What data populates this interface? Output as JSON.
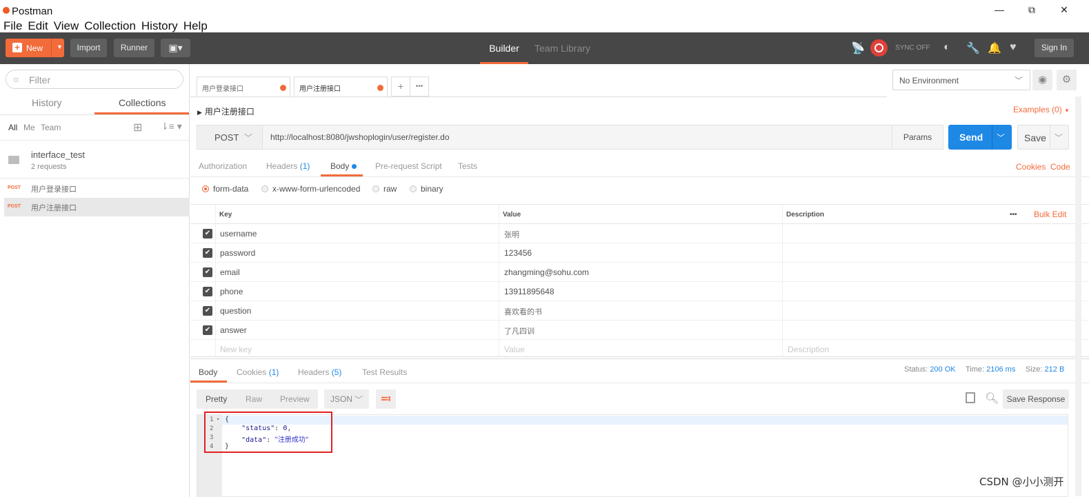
{
  "window": {
    "title": "Postman",
    "minimize": "—",
    "restore": "⧉",
    "close": "✕"
  },
  "menu": [
    "File",
    "Edit",
    "View",
    "Collection",
    "History",
    "Help"
  ],
  "header": {
    "new_label": "New",
    "import_label": "Import",
    "runner_label": "Runner",
    "builder_label": "Builder",
    "team_library_label": "Team Library",
    "sync_label": "SYNC OFF",
    "signin_label": "Sign In"
  },
  "sidebar": {
    "filter_placeholder": "Filter",
    "tabs": {
      "history": "History",
      "collections": "Collections"
    },
    "filters": {
      "all": "All",
      "me": "Me",
      "team": "Team"
    },
    "collection": {
      "name": "interface_test",
      "count": "2 requests"
    },
    "requests": [
      {
        "method": "POST",
        "name": "用户登录接口"
      },
      {
        "method": "POST",
        "name": "用户注册接口"
      }
    ]
  },
  "tabs": [
    {
      "label": "用户登录接口"
    },
    {
      "label": "用户注册接口"
    }
  ],
  "tab_actions": {
    "add": "+",
    "more": "•••"
  },
  "environment": {
    "selected": "No Environment"
  },
  "request": {
    "name": "用户注册接口",
    "examples": "Examples (0)",
    "method": "POST",
    "url": "http://localhost:8080/jwshoplogin/user/register.do",
    "params_label": "Params",
    "send_label": "Send",
    "save_label": "Save"
  },
  "request_tabs": {
    "authorization": "Authorization",
    "headers": "Headers",
    "headers_count": "(1)",
    "body": "Body",
    "pre_request": "Pre-request Script",
    "tests": "Tests",
    "cookies": "Cookies",
    "code": "Code"
  },
  "body_types": [
    "form-data",
    "x-www-form-urlencoded",
    "raw",
    "binary"
  ],
  "kv_table": {
    "headers": {
      "key": "Key",
      "value": "Value",
      "description": "Description"
    },
    "bulk_edit": "Bulk Edit",
    "more": "•••",
    "rows": [
      {
        "key": "username",
        "value": "张明"
      },
      {
        "key": "password",
        "value": "123456"
      },
      {
        "key": "email",
        "value": "zhangming@sohu.com"
      },
      {
        "key": "phone",
        "value": "13911895648"
      },
      {
        "key": "question",
        "value": "喜欢看的书"
      },
      {
        "key": "answer",
        "value": "了凡四训"
      }
    ],
    "placeholders": {
      "key": "New key",
      "value": "Value",
      "description": "Description"
    }
  },
  "response": {
    "tabs": {
      "body": "Body",
      "cookies": "Cookies",
      "cookies_count": "(1)",
      "headers": "Headers",
      "headers_count": "(5)",
      "test_results": "Test Results"
    },
    "status_label": "Status:",
    "status_value": "200 OK",
    "time_label": "Time:",
    "time_value": "2106 ms",
    "size_label": "Size:",
    "size_value": "212 B",
    "views": [
      "Pretty",
      "Raw",
      "Preview"
    ],
    "format": "JSON",
    "save_response": "Save Response",
    "lines": [
      "1",
      "2",
      "3",
      "4"
    ],
    "code": {
      "open": "{",
      "status_key": "\"status\"",
      "status_val": "0",
      "data_key": "\"data\"",
      "data_val": "\"注册成功\"",
      "close": "}"
    }
  },
  "watermark": "CSDN @小小测开",
  "colors": {
    "accent": "#f26b3a",
    "header": "#474747",
    "send": "#1e88e5",
    "highlight_box": "#e02020"
  }
}
